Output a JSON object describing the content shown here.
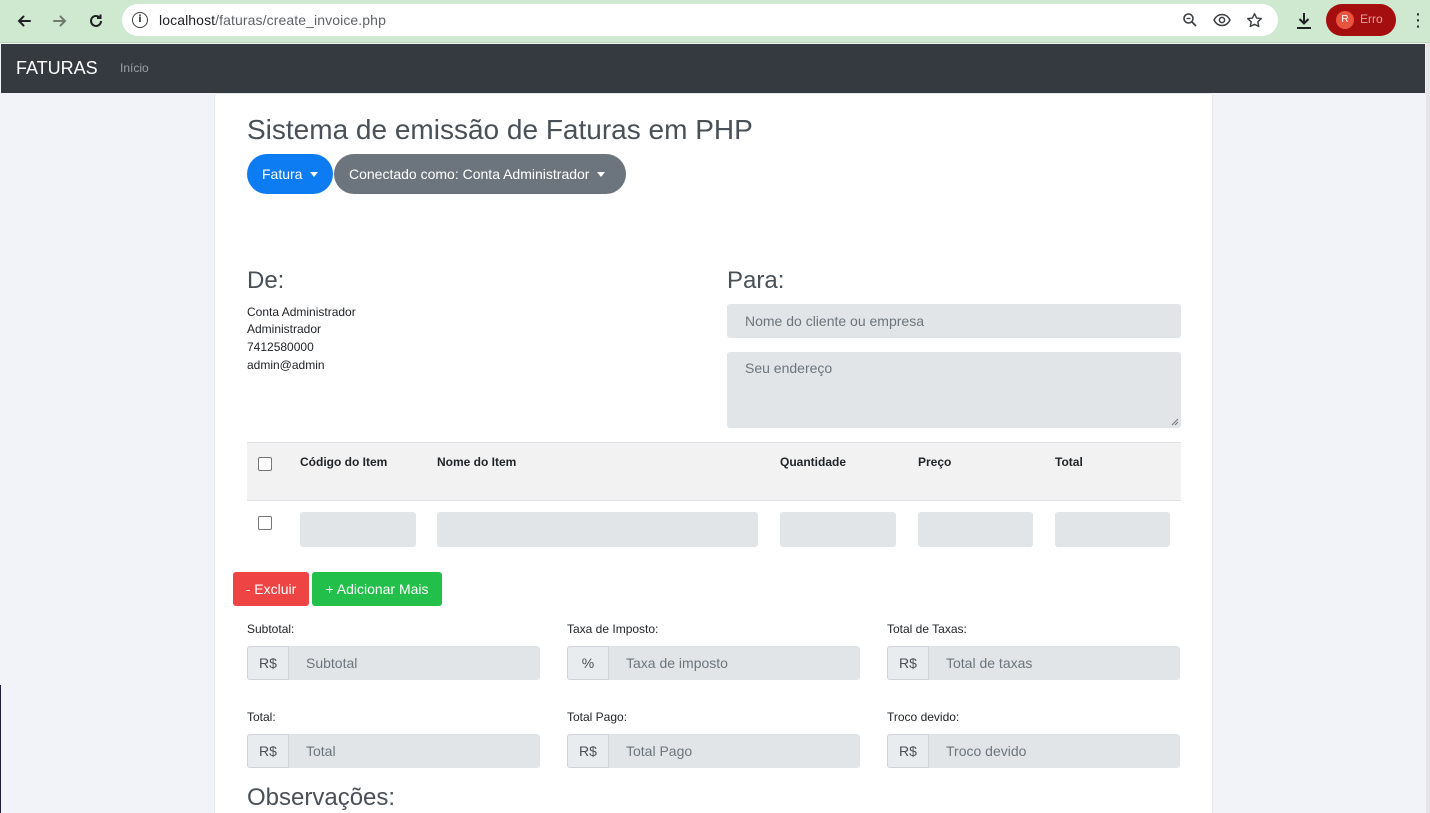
{
  "browser": {
    "url_host": "localhost",
    "url_path": "/faturas/create_invoice.php",
    "profile_initial": "R",
    "profile_status": "Erro",
    "icons": [
      "back-icon",
      "forward-icon",
      "reload-icon",
      "site-info-icon",
      "zoom-icon",
      "eye-icon",
      "star-icon",
      "download-icon",
      "menu-icon"
    ]
  },
  "navbar": {
    "brand": "FATURAS",
    "home_link": "Início"
  },
  "page": {
    "title": "Sistema de emissão de Faturas em PHP",
    "invoice_menu": "Fatura",
    "user_menu": "Conectado como: Conta Administrador"
  },
  "from": {
    "heading": "De:",
    "lines": [
      "Conta Administrador",
      "Administrador",
      "7412580000",
      "admin@admin"
    ]
  },
  "to": {
    "heading": "Para:",
    "name_placeholder": "Nome do cliente ou empresa",
    "address_placeholder": "Seu endereço"
  },
  "items_table": {
    "columns": [
      "Código do Item",
      "Nome do Item",
      "Quantidade",
      "Preço",
      "Total"
    ]
  },
  "buttons": {
    "delete": "- Excluir",
    "add_more": "+ Adicionar Mais"
  },
  "totals": {
    "subtotal": {
      "label": "Subtotal:",
      "addon": "R$",
      "placeholder": "Subtotal"
    },
    "tax_rate": {
      "label": "Taxa de Imposto:",
      "addon": "%",
      "placeholder": "Taxa de imposto"
    },
    "tax_total": {
      "label": "Total de Taxas:",
      "addon": "R$",
      "placeholder": "Total de taxas"
    },
    "total": {
      "label": "Total:",
      "addon": "R$",
      "placeholder": "Total"
    },
    "paid": {
      "label": "Total Pago:",
      "addon": "R$",
      "placeholder": "Total Pago"
    },
    "change": {
      "label": "Troco devido:",
      "addon": "R$",
      "placeholder": "Troco devido"
    }
  },
  "notes": {
    "heading": "Observações:"
  },
  "colors": {
    "primary": "#0d7cf2",
    "secondary": "#6c757d",
    "danger": "#ef4444",
    "success": "#22c04a",
    "navbar": "#343a40"
  }
}
